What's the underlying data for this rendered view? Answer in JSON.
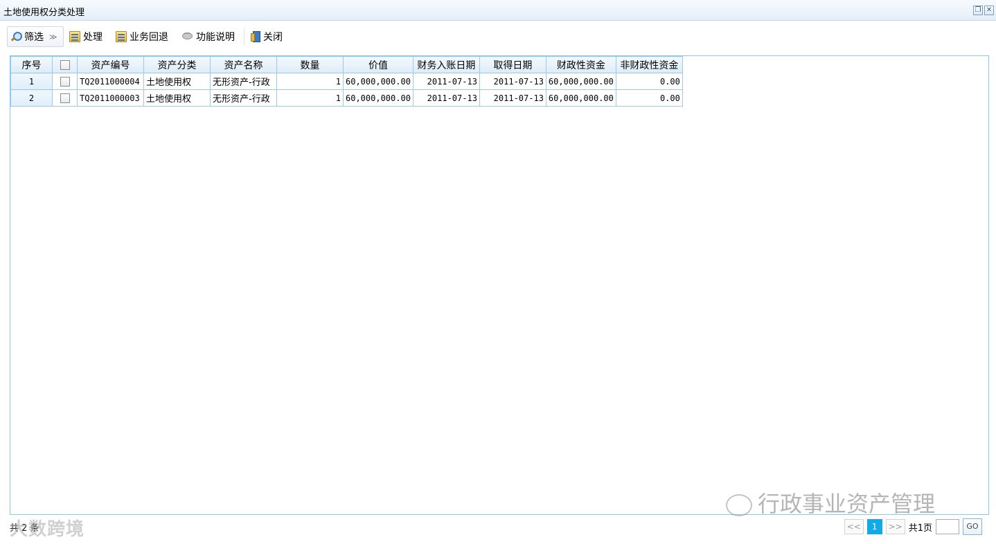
{
  "window": {
    "title": "土地使用权分类处理",
    "restore_icon": "restore-icon",
    "close_icon": "close-icon"
  },
  "toolbar": {
    "filter_label": "筛选",
    "process_label": "处理",
    "rollback_label": "业务回退",
    "help_label": "功能说明",
    "close_label": "关闭"
  },
  "grid": {
    "headers": [
      "序号",
      "",
      "资产编号",
      "资产分类",
      "资产名称",
      "数量",
      "价值",
      "财务入账日期",
      "取得日期",
      "财政性资金",
      "非财政性资金"
    ],
    "rows": [
      {
        "seq": "1",
        "code": "TQ2011000004",
        "category": "土地使用权",
        "name": "无形资产-行政",
        "qty": "1",
        "value": "60,000,000.00",
        "book_date": "2011-07-13",
        "acq_date": "2011-07-13",
        "fiscal": "60,000,000.00",
        "nonfiscal": "0.00"
      },
      {
        "seq": "2",
        "code": "TQ2011000003",
        "category": "土地使用权",
        "name": "无形资产-行政",
        "qty": "1",
        "value": "60,000,000.00",
        "book_date": "2011-07-13",
        "acq_date": "2011-07-13",
        "fiscal": "60,000,000.00",
        "nonfiscal": "0.00"
      }
    ]
  },
  "footer": {
    "total_text": "共 2 条",
    "prev_label": "<<",
    "current_page": "1",
    "next_label": ">>",
    "page_count_text": "共1页",
    "go_label": "GO"
  },
  "watermarks": {
    "left": "大数跨境",
    "right": "行政事业资产管理"
  },
  "colors": {
    "grid_border": "#9cc8e6",
    "pager_active": "#12a9e8"
  }
}
